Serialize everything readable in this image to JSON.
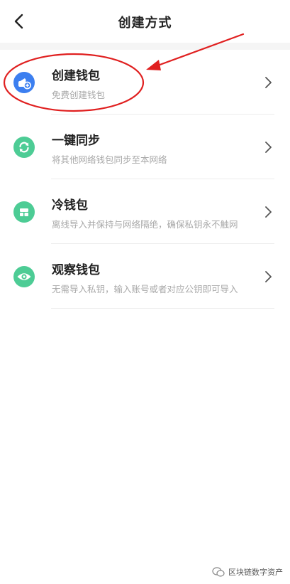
{
  "header": {
    "title": "创建方式"
  },
  "items": [
    {
      "id": "create",
      "title": "创建钱包",
      "subtitle": "免费创建钱包",
      "icon": "wallet-add-icon",
      "color": "#3c7ff0"
    },
    {
      "id": "sync",
      "title": "一键同步",
      "subtitle": "将其他网络钱包同步至本网络",
      "icon": "sync-icon",
      "color": "#4dcc95"
    },
    {
      "id": "cold",
      "title": "冷钱包",
      "subtitle": "离线导入并保持与网络隔绝，确保私钥永不触网",
      "icon": "cold-wallet-icon",
      "color": "#4dcc95"
    },
    {
      "id": "watch",
      "title": "观察钱包",
      "subtitle": "无需导入私钥，输入账号或者对应公钥即可导入",
      "icon": "eye-icon",
      "color": "#4dcc95"
    }
  ],
  "watermark": {
    "text": "区块链数字资产"
  },
  "colors": {
    "annotation": "#e02020",
    "primary_blue": "#3c7ff0",
    "green": "#4dcc95"
  }
}
